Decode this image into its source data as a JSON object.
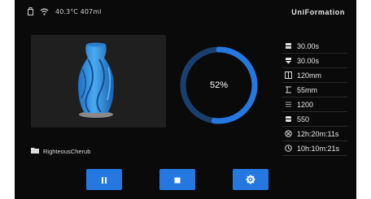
{
  "statusbar": {
    "temperature_filesize": "40.3°C 407ml",
    "brand": "UniFormation"
  },
  "progress": {
    "label": "52%",
    "fraction": 0.52
  },
  "stats": [
    {
      "icon": "layer-time-icon",
      "value": "30.00s"
    },
    {
      "icon": "exposure-time-icon",
      "value": "30.00s"
    },
    {
      "icon": "width-icon",
      "value": "120mm"
    },
    {
      "icon": "height-icon",
      "value": "55mm"
    },
    {
      "icon": "layers-icon",
      "value": "1200"
    },
    {
      "icon": "current-layer-icon",
      "value": "550"
    },
    {
      "icon": "elapsed-time-icon",
      "value": "12h:20m:11s"
    },
    {
      "icon": "remaining-time-icon",
      "value": "10h:10m:21s"
    }
  ],
  "file": {
    "name": "RighteousCherub"
  },
  "colors": {
    "accent": "#2478e0",
    "background": "#0a0a0a",
    "panel": "#1f1f1f",
    "model": "#3a9be8"
  }
}
